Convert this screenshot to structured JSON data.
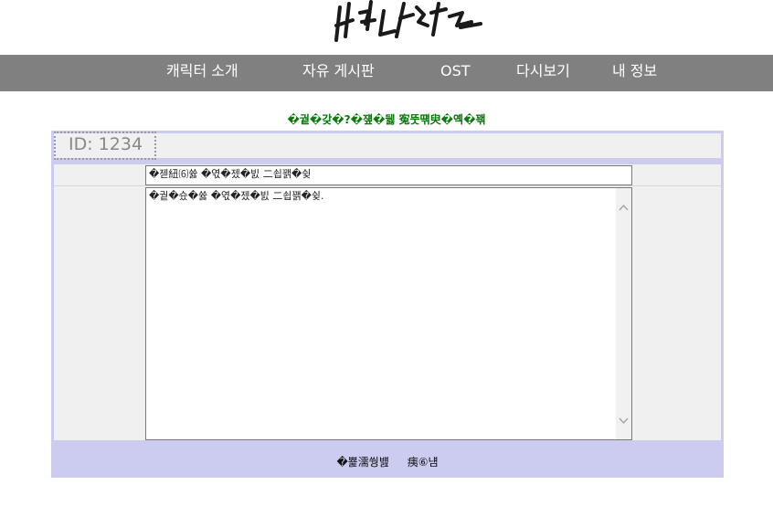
{
  "logo": {
    "alt": "나쁜 녀석들"
  },
  "nav": {
    "items": [
      {
        "label": "캐릭터 소개"
      },
      {
        "label": "자유 게시판"
      },
      {
        "label": "OST"
      },
      {
        "label": "다시보기"
      },
      {
        "label": "내 정보"
      }
    ]
  },
  "notice": "�궡�갖�?�쟾�뒗 寃뚯떆臾�옉�꽦",
  "form": {
    "id_label": "ID: 1234",
    "title_value": "�젣紐⑹쓣 �엯�젰�빐 二쇱꽭�슂",
    "content_value": "�궡�슜�쓣 �엯�젰�빐 二쇱꽭�슂.",
    "submit_label": "�뾽濡쒕뱶",
    "cancel_label": "痍⑥냼"
  },
  "colors": {
    "nav_bg": "#808080",
    "form_border": "#cccbf0",
    "notice_text": "#0a7a0a"
  },
  "icons": {
    "scroll_up": "chevron-up-icon",
    "scroll_down": "chevron-down-icon"
  }
}
